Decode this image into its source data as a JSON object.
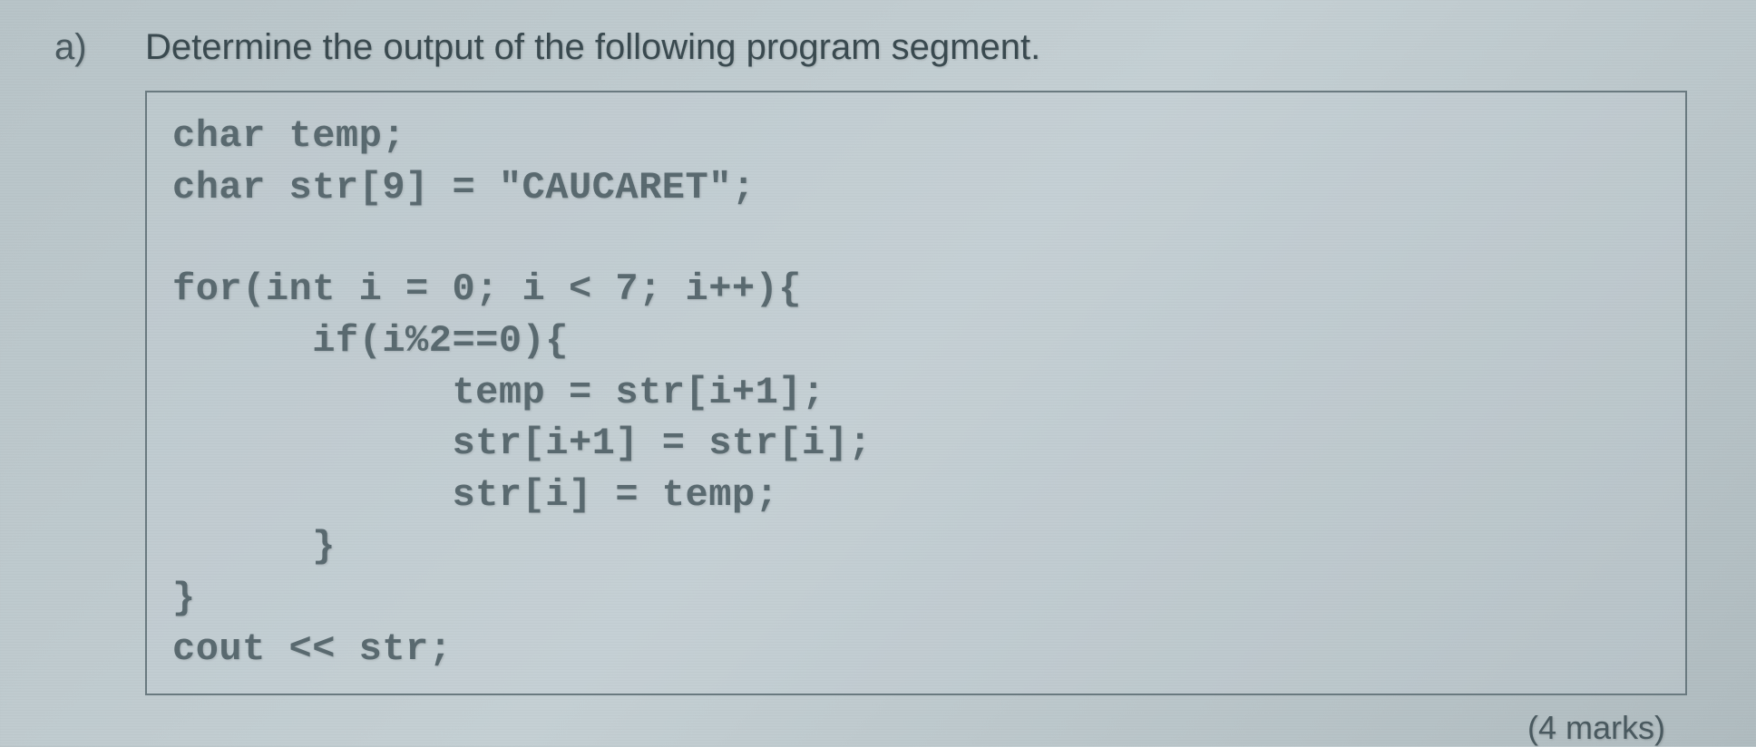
{
  "question": {
    "label": "a)",
    "text": "Determine the output of the following program segment."
  },
  "code": {
    "lines": [
      "char temp;",
      "char str[9] = \"CAUCARET\";",
      "",
      "for(int i = 0; i < 7; i++){",
      "      if(i%2==0){",
      "            temp = str[i+1];",
      "            str[i+1] = str[i];",
      "            str[i] = temp;",
      "      }",
      "}",
      "cout << str;"
    ]
  },
  "marks": "(4 marks)"
}
